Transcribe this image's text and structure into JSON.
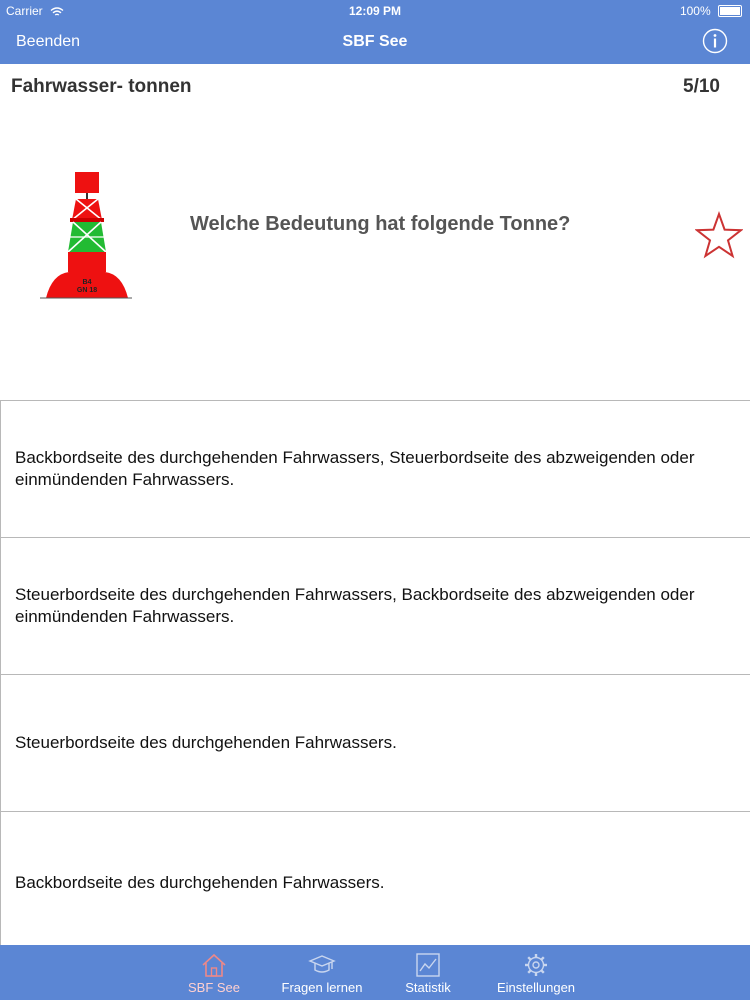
{
  "status_bar": {
    "carrier": "Carrier",
    "time": "12:09 PM",
    "battery": "100%"
  },
  "nav": {
    "left_button": "Beenden",
    "title": "SBF See",
    "info_icon": "info-icon"
  },
  "quiz": {
    "category": "Fahrwasser- tonnen",
    "progress": "5/10",
    "buoy_label_top": "B4",
    "buoy_label_bottom": "GN 18",
    "question": "Welche Bedeutung hat folgende Tonne?",
    "star_icon": "star-outline-icon",
    "answers": [
      "Backbordseite des durchgehenden Fahrwassers, Steuerbordseite des abzweigenden oder einmündenden Fahrwassers.",
      "Steuerbordseite des durchgehenden Fahrwassers, Backbordseite des abzweigenden oder einmündenden Fahrwassers.",
      "Steuerbordseite des durchgehenden Fahrwassers.",
      "Backbordseite des durchgehenden Fahrwassers."
    ]
  },
  "tabbar": {
    "tabs": [
      {
        "label": "SBF See",
        "icon": "home-icon",
        "active": true
      },
      {
        "label": "Fragen lernen",
        "icon": "graduation-cap-icon",
        "active": false
      },
      {
        "label": "Statistik",
        "icon": "chart-icon",
        "active": false
      },
      {
        "label": "Einstellungen",
        "icon": "gear-icon",
        "active": false
      }
    ]
  },
  "colors": {
    "bar_blue": "#5b86d4",
    "buoy_red": "#ee1111",
    "buoy_green": "#22bb33",
    "star_red": "#cc3333"
  }
}
